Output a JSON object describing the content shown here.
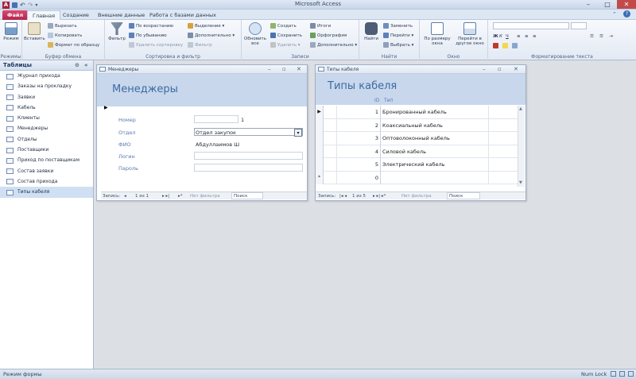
{
  "window": {
    "title": "Microsoft Access",
    "controls": [
      "–",
      "□",
      "✕"
    ]
  },
  "ribbon": {
    "tabs": [
      "Файл",
      "Главная",
      "Создание",
      "Внешние данные",
      "Работа с базами данных"
    ],
    "active_tab": 1,
    "groups": {
      "views": {
        "label": "Режимы",
        "view": "Режим"
      },
      "clipboard": {
        "label": "Буфер обмена",
        "paste": "Вставить",
        "cut": "Вырезать",
        "copy": "Копировать",
        "format": "Формат по образцу"
      },
      "sort": {
        "label": "Сортировка и фильтр",
        "filter": "Фильтр",
        "asc": "По возрастанию",
        "desc": "По убыванию",
        "remove": "Удалить сортировку",
        "select": "Выделение",
        "advanced": "Дополнительно",
        "toggle": "Фильтр"
      },
      "records": {
        "label": "Записи",
        "refresh": "Обновить все",
        "new": "Создать",
        "save": "Сохранить",
        "delete": "Удалить",
        "totals": "Итоги",
        "spelling": "Орфография",
        "more": "Дополнительно"
      },
      "find": {
        "label": "Найти",
        "find": "Найти",
        "replace": "Заменить",
        "goto": "Перейти",
        "select": "Выбрать"
      },
      "window": {
        "label": "Окно",
        "fit": "По размеру окна",
        "switch": "Перейти в другое окно"
      },
      "text": {
        "label": "Форматирование текста"
      }
    }
  },
  "nav": {
    "header": "Таблицы",
    "items": [
      "Журнал прихода",
      "Заказы на прокладку",
      "Заявки",
      "Кабель",
      "Клиенты",
      "Менеджеры",
      "Отделы",
      "Поставщики",
      "Приход по поставщикам",
      "Состав заявки",
      "Состав прихода",
      "Типы кабеля"
    ],
    "selected": 11
  },
  "form": {
    "window_title": "Менеджеры",
    "header": "Менеджеры",
    "fields": [
      {
        "label": "Номер",
        "value": "1"
      },
      {
        "label": "Отдел",
        "value": "Отдел закупок"
      },
      {
        "label": "ФИО",
        "value": "Абдуллаимов Ш"
      },
      {
        "label": "Логин",
        "value": ""
      },
      {
        "label": "Пароль",
        "value": ""
      }
    ],
    "recnav": {
      "prefix": "Запись:",
      "pos": "1 из 1",
      "filter": "Нет фильтра",
      "search": "Поиск"
    }
  },
  "datasheet": {
    "window_title": "Типы кабеля",
    "header": "Типы кабеля",
    "columns": [
      "ID",
      "Тип"
    ],
    "rows": [
      {
        "id": "1",
        "type": "Бронированный кабель"
      },
      {
        "id": "2",
        "type": "Коаксиальный кабель"
      },
      {
        "id": "3",
        "type": "Оптоволоконный кабель"
      },
      {
        "id": "4",
        "type": "Силовой кабель"
      },
      {
        "id": "5",
        "type": "Электрический кабель"
      },
      {
        "id": "0",
        "type": ""
      }
    ],
    "recnav": {
      "prefix": "Запись:",
      "pos": "1 из 5",
      "filter": "Нет фильтра",
      "search": "Поиск"
    }
  },
  "status": {
    "left": "Режим формы",
    "right": "Num Lock"
  }
}
